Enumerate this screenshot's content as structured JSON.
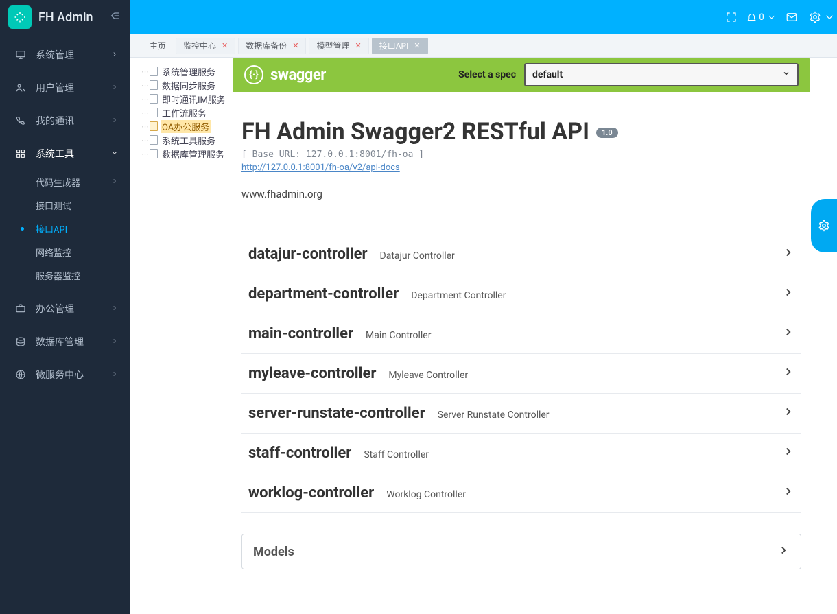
{
  "brand": "FH Admin",
  "notif_count": "0",
  "sidebar": {
    "items": [
      {
        "label": "系统管理"
      },
      {
        "label": "用户管理"
      },
      {
        "label": "我的通讯"
      },
      {
        "label": "系统工具"
      },
      {
        "label": "办公管理"
      },
      {
        "label": "数据库管理"
      },
      {
        "label": "微服务中心"
      }
    ],
    "submenu": [
      {
        "label": "代码生成器"
      },
      {
        "label": "接口测试"
      },
      {
        "label": "接口API"
      },
      {
        "label": "网络监控"
      },
      {
        "label": "服务器监控"
      }
    ]
  },
  "tabs": [
    {
      "label": "主页"
    },
    {
      "label": "监控中心"
    },
    {
      "label": "数据库备份"
    },
    {
      "label": "模型管理"
    },
    {
      "label": "接口API"
    }
  ],
  "service_tree": [
    {
      "label": "系统管理服务"
    },
    {
      "label": "数据同步服务"
    },
    {
      "label": "即时通讯IM服务"
    },
    {
      "label": "工作流服务"
    },
    {
      "label": "OA办公服务"
    },
    {
      "label": "系统工具服务"
    },
    {
      "label": "数据库管理服务"
    }
  ],
  "swagger": {
    "logo_text": "swagger",
    "spec_label": "Select a spec",
    "spec_value": "default",
    "title": "FH Admin Swagger2 RESTful API",
    "version": "1.0",
    "base_url": "[ Base URL: 127.0.0.1:8001/fh-oa ]",
    "docs_url": "http://127.0.0.1:8001/fh-oa/v2/api-docs",
    "org": "www.fhadmin.org",
    "models_label": "Models",
    "controllers": [
      {
        "name": "datajur-controller",
        "desc": "Datajur Controller"
      },
      {
        "name": "department-controller",
        "desc": "Department Controller"
      },
      {
        "name": "main-controller",
        "desc": "Main Controller"
      },
      {
        "name": "myleave-controller",
        "desc": "Myleave Controller"
      },
      {
        "name": "server-runstate-controller",
        "desc": "Server Runstate Controller"
      },
      {
        "name": "staff-controller",
        "desc": "Staff Controller"
      },
      {
        "name": "worklog-controller",
        "desc": "Worklog Controller"
      }
    ]
  }
}
